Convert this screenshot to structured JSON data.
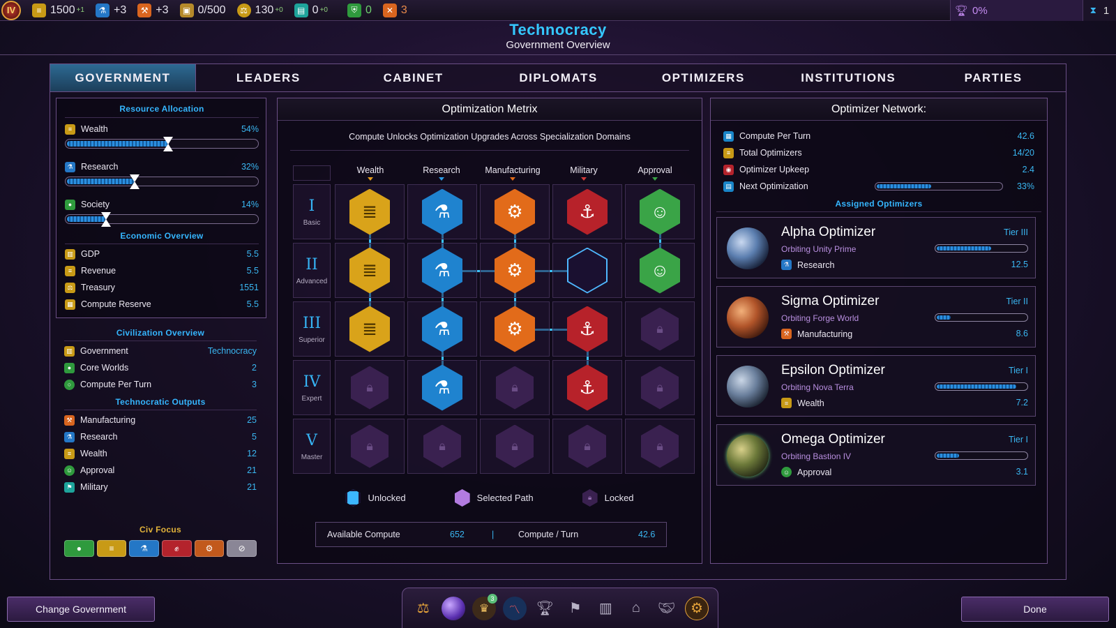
{
  "topbar": {
    "emblem": "IV",
    "resources": [
      {
        "icon": "coin-stack-icon",
        "value": "1500",
        "delta": "+1",
        "color": "#c89a16"
      },
      {
        "icon": "flask-icon",
        "value": "+3",
        "delta": "",
        "color": "#2477c6"
      },
      {
        "icon": "hammer-icon",
        "value": "+3",
        "delta": "",
        "color": "#d9651f"
      },
      {
        "icon": "storage-icon",
        "value": "0/500",
        "delta": "",
        "color": "#b58a2a"
      },
      {
        "icon": "balance-icon",
        "value": "130",
        "delta": "+0",
        "color": "#c89a16"
      },
      {
        "icon": "population-icon",
        "value": "0",
        "delta": "+0",
        "color": "#1ea49b"
      },
      {
        "icon": "shield-icon",
        "value": "0",
        "delta": "",
        "color": "#2f9a3d"
      },
      {
        "icon": "crossed-swords-icon",
        "value": "3",
        "delta": "",
        "color": "#d9651f"
      }
    ],
    "victory_pct": "0%",
    "turn": "1"
  },
  "header": {
    "title": "Technocracy",
    "subtitle": "Government Overview"
  },
  "tabs": [
    {
      "label": "GOVERNMENT",
      "active": true
    },
    {
      "label": "LEADERS",
      "active": false
    },
    {
      "label": "CABINET",
      "active": false
    },
    {
      "label": "DIPLOMATS",
      "active": false
    },
    {
      "label": "OPTIMIZERS",
      "active": false
    },
    {
      "label": "INSTITUTIONS",
      "active": false
    },
    {
      "label": "PARTIES",
      "active": false
    }
  ],
  "left": {
    "resource_allocation_title": "Resource Allocation",
    "allocations": [
      {
        "label": "Wealth",
        "pct": "54%",
        "fraction": 0.54
      },
      {
        "label": "Research",
        "pct": "32%",
        "fraction": 0.32
      },
      {
        "label": "Society",
        "pct": "14%",
        "fraction": 0.14
      }
    ],
    "economic_title": "Economic Overview",
    "economic": [
      {
        "label": "GDP",
        "value": "5.5"
      },
      {
        "label": "Revenue",
        "value": "5.5"
      },
      {
        "label": "Treasury",
        "value": "1551"
      },
      {
        "label": "Compute Reserve",
        "value": "5.5"
      }
    ],
    "civ_title": "Civilization Overview",
    "civ": [
      {
        "label": "Government",
        "value": "Technocracy"
      },
      {
        "label": "Core Worlds",
        "value": "2"
      },
      {
        "label": "Compute Per Turn",
        "value": "3"
      }
    ],
    "outputs_title": "Technocratic Outputs",
    "outputs": [
      {
        "label": "Manufacturing",
        "value": "25"
      },
      {
        "label": "Research",
        "value": "5"
      },
      {
        "label": "Wealth",
        "value": "12"
      },
      {
        "label": "Approval",
        "value": "21"
      },
      {
        "label": "Military",
        "value": "21"
      }
    ],
    "focus_title": "Civ Focus"
  },
  "matrix": {
    "title": "Optimization Metrix",
    "subtitle": "Compute Unlocks Optimization Upgrades Across Specialization Domains",
    "columns": [
      "Wealth",
      "Research",
      "Manufacturing",
      "Military",
      "Approval"
    ],
    "tiers": [
      {
        "numeral": "I",
        "name": "Basic"
      },
      {
        "numeral": "II",
        "name": "Advanced"
      },
      {
        "numeral": "III",
        "name": "Superior"
      },
      {
        "numeral": "IV",
        "name": "Expert"
      },
      {
        "numeral": "V",
        "name": "Master"
      }
    ],
    "legend": {
      "unlocked": "Unlocked",
      "selected": "Selected Path",
      "locked": "Locked"
    },
    "available_compute_label": "Available Compute",
    "available_compute": "652",
    "separator": "|",
    "compute_turn_label": "Compute / Turn",
    "compute_turn": "42.6"
  },
  "network": {
    "title": "Optimizer Network:",
    "stats": [
      {
        "label": "Compute Per Turn",
        "value": "42.6"
      },
      {
        "label": "Total Optimizers",
        "value": "14/20"
      },
      {
        "label": "Optimizer Upkeep",
        "value": "2.4"
      },
      {
        "label": "Next Optimization",
        "value": "33%",
        "fraction": 0.33
      }
    ],
    "assigned_title": "Assigned Optimizers",
    "optimizers": [
      {
        "name": "Alpha Optimizer",
        "tier": "Tier III",
        "orbit": "Orbiting Unity Prime",
        "spec": "Research",
        "value": "12.5",
        "fraction": 0.6
      },
      {
        "name": "Sigma Optimizer",
        "tier": "Tier II",
        "orbit": "Orbiting Forge World",
        "spec": "Manufacturing",
        "value": "8.6",
        "fraction": 0.15
      },
      {
        "name": "Epsilon Optimizer",
        "tier": "Tier I",
        "orbit": "Orbiting Nova Terra",
        "spec": "Wealth",
        "value": "7.2",
        "fraction": 0.88
      },
      {
        "name": "Omega Optimizer",
        "tier": "Tier I",
        "orbit": "Orbiting Bastion IV",
        "spec": "Approval",
        "value": "3.1",
        "fraction": 0.25
      }
    ]
  },
  "bottom": {
    "change_label": "Change Government",
    "done_label": "Done",
    "dock_badge": "3"
  }
}
